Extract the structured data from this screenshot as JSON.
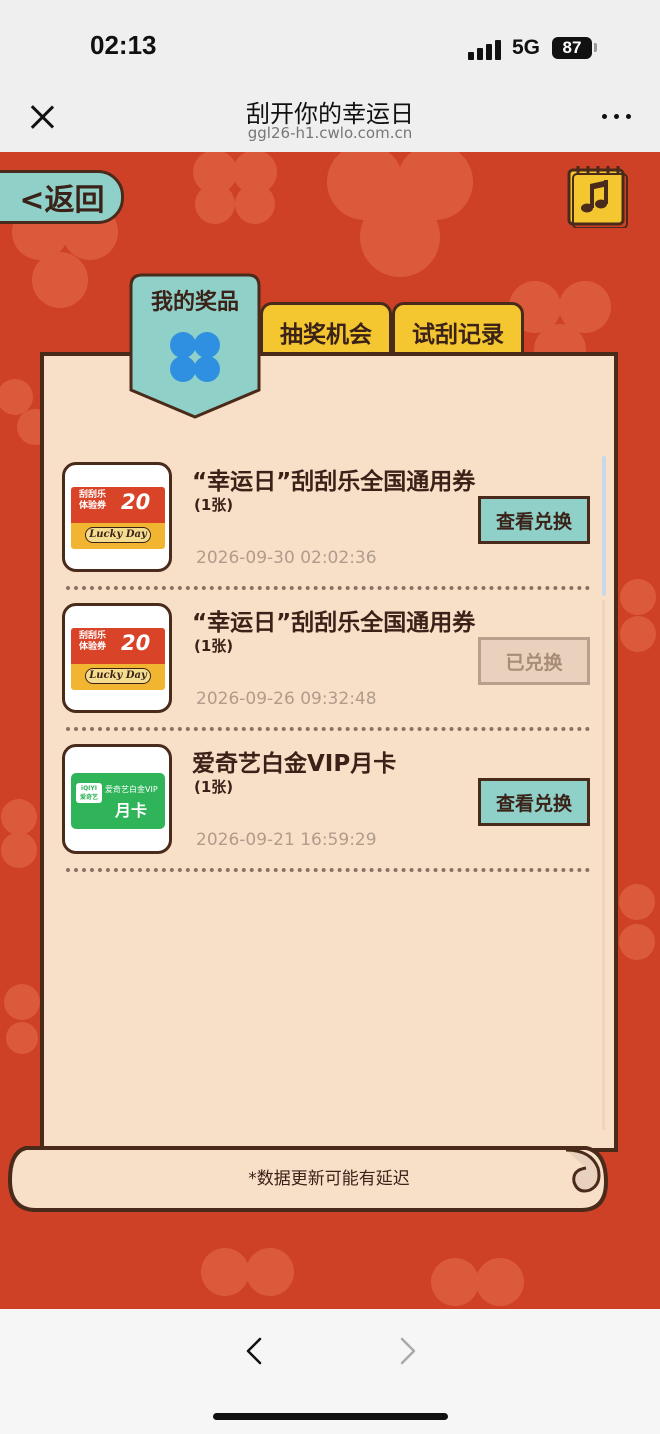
{
  "status_bar": {
    "time": "02:13",
    "network": "5G",
    "battery": "87"
  },
  "nav": {
    "title": "刮开你的幸运日",
    "url": "ggl26-h1.cwlo.com.cn"
  },
  "page": {
    "back_label": "<返回",
    "tabs": [
      {
        "label": "我的奖品",
        "active": true
      },
      {
        "label": "抽奖机会",
        "active": false
      },
      {
        "label": "试刮记录",
        "active": false
      }
    ],
    "footnote": "*数据更新可能有延迟",
    "colors": {
      "background": "#cf4126",
      "panel": "#f8e0c8",
      "teal": "#8fd0c8",
      "yellow": "#f4c62f",
      "outline": "#4a2a1a"
    }
  },
  "prizes": [
    {
      "title": "“幸运日”刮刮乐全国通用券",
      "count": "(1张)",
      "date": "2026-09-30 02:02:36",
      "button": "查看兑换",
      "redeemed": false,
      "thumb": {
        "line1": "刮刮乐",
        "line2": "体验券",
        "amount": "20",
        "badge": "Lucky Day"
      }
    },
    {
      "title": "“幸运日”刮刮乐全国通用券",
      "count": "(1张)",
      "date": "2026-09-26 09:32:48",
      "button": "已兑换",
      "redeemed": true,
      "thumb": {
        "line1": "刮刮乐",
        "line2": "体验券",
        "amount": "20",
        "badge": "Lucky Day"
      }
    },
    {
      "title": "爱奇艺白金VIP月卡",
      "count": "(1张)",
      "date": "2026-09-21 16:59:29",
      "button": "查看兑换",
      "redeemed": false,
      "thumb": {
        "logo": "iQIYI\n爱奇艺",
        "top": "爱奇艺白金VIP",
        "main": "月卡"
      }
    }
  ],
  "icons": {
    "close": "close-icon",
    "more": "more-icon",
    "music": "music-icon",
    "clover": "clover-icon",
    "back": "chevron-left-icon",
    "forward": "chevron-right-icon"
  }
}
